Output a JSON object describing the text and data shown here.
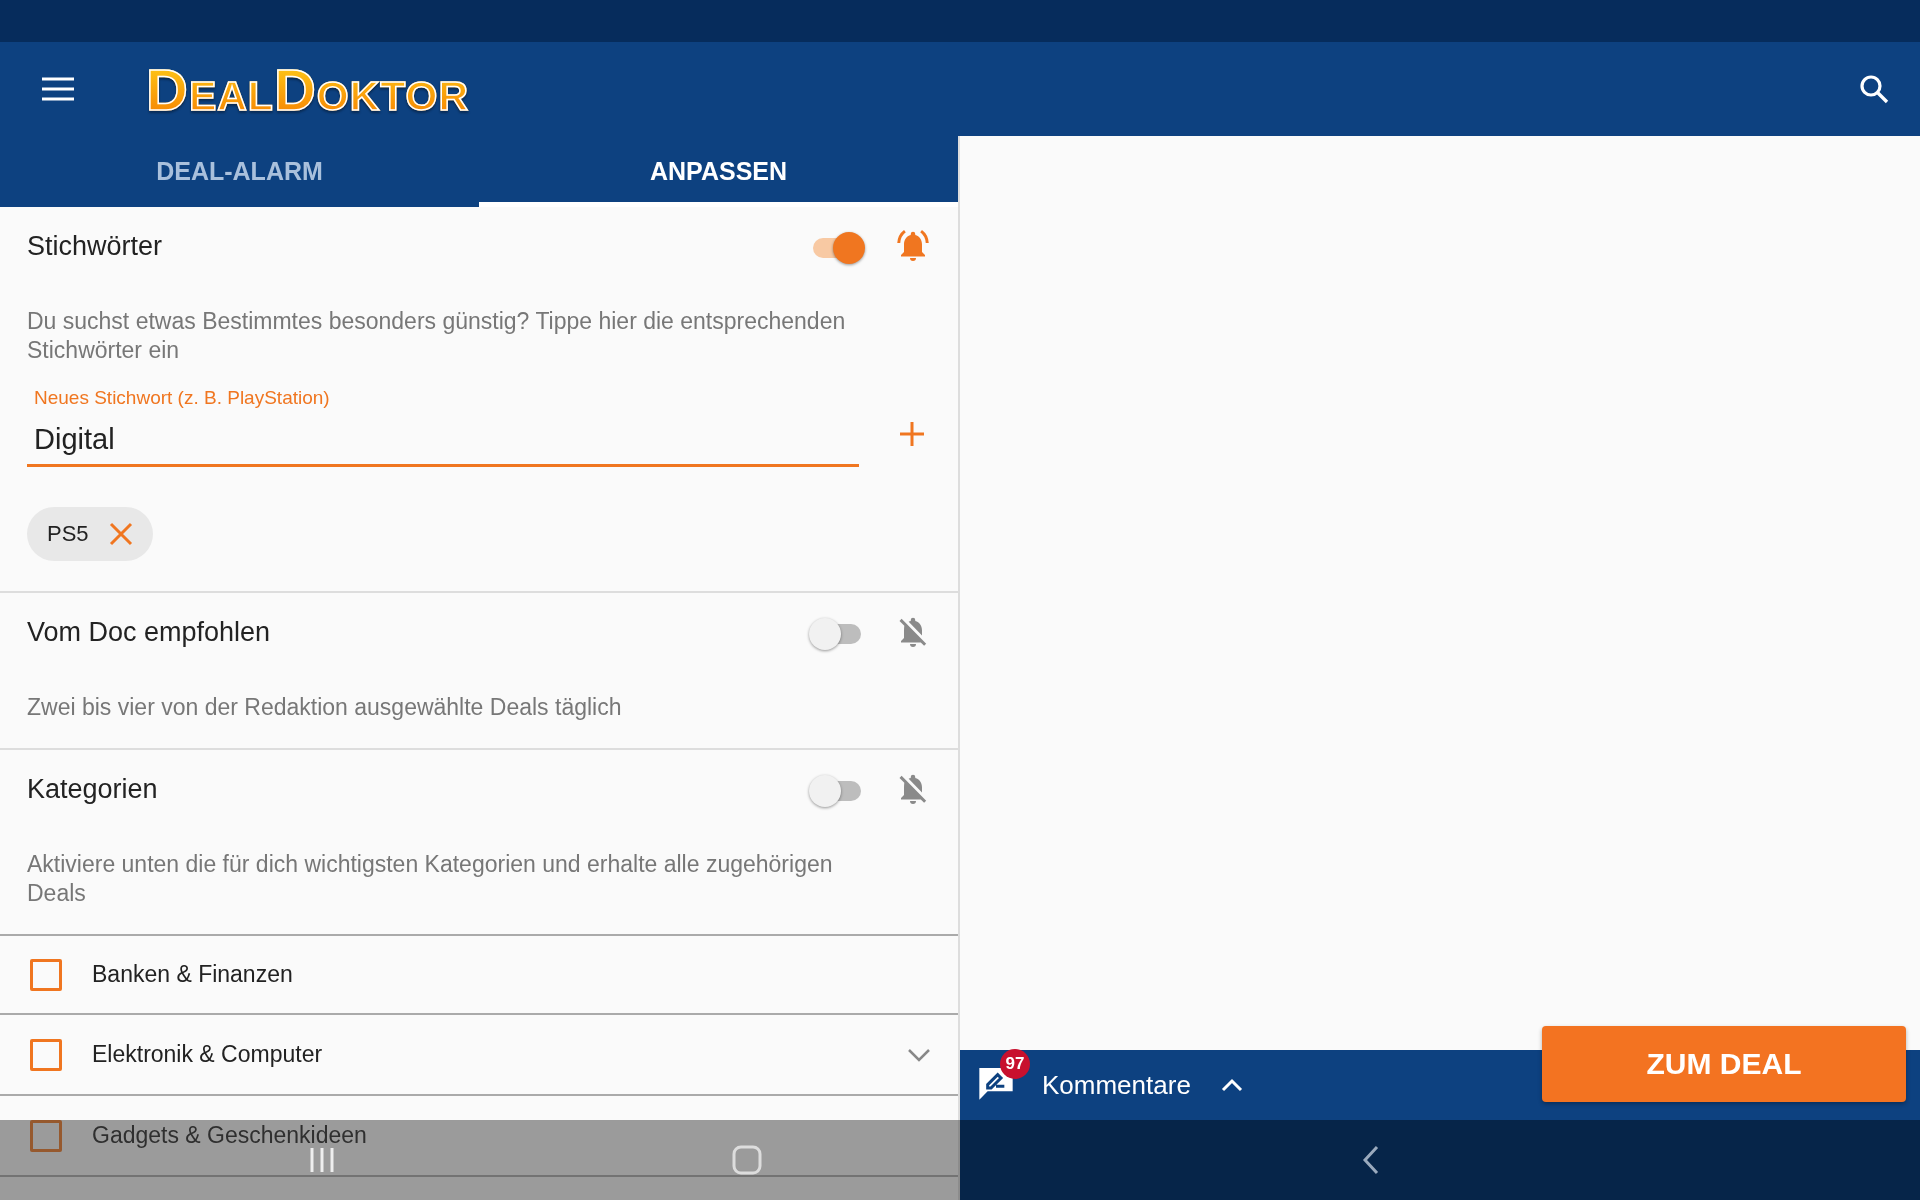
{
  "header": {
    "logo": "DealDoktor"
  },
  "tabs": [
    {
      "label": "DEAL-ALARM",
      "selected": false
    },
    {
      "label": "ANPASSEN",
      "selected": true
    }
  ],
  "sections": [
    {
      "title": "Stichwörter",
      "on": true,
      "description": "Du suchst etwas Bestimmtes besonders günstig? Tippe hier die entsprechenden Stichwörter ein",
      "keyword_field": {
        "label": "Neues Stichwort (z. B. PlayStation)",
        "value": "Digital"
      },
      "keywords": [
        "PS5"
      ]
    },
    {
      "title": "Vom Doc empfohlen",
      "on": false,
      "description": "Zwei bis vier von der Redaktion ausgewählte Deals täglich"
    },
    {
      "title": "Kategorien",
      "on": false,
      "description": "Aktiviere unten die für dich wichtigsten Kategorien und erhalte alle zugehörigen Deals"
    }
  ],
  "categories": [
    {
      "label": "Banken & Finanzen",
      "checked": false
    },
    {
      "label": "Elektronik & Computer",
      "checked": false,
      "expanded": false
    },
    {
      "label": "Gadgets & Geschenkideen",
      "checked": false
    }
  ],
  "comments_bar": {
    "badge": "97",
    "label": "Kommentare",
    "expanded": false
  },
  "deal_button": "ZUM DEAL"
}
